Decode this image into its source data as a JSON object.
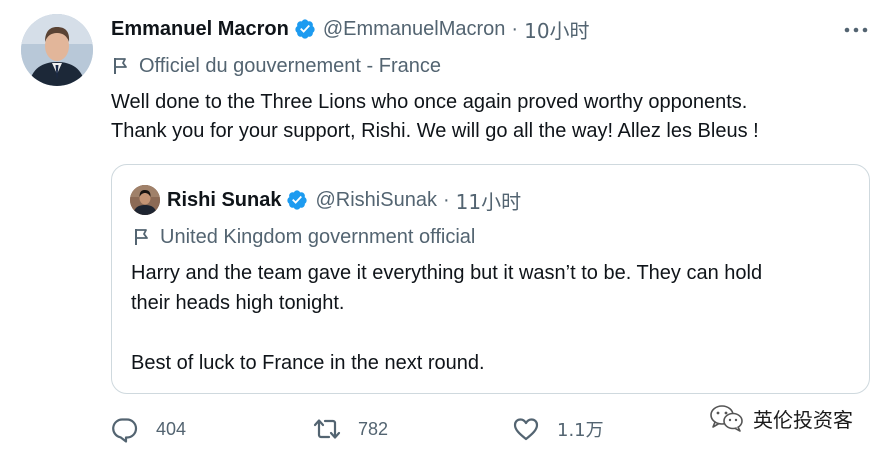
{
  "tweet": {
    "author_name": "Emmanuel Macron",
    "author_handle": "@EmmanuelMacron",
    "separator": "·",
    "time": "10小时",
    "label": "Officiel du gouvernement - France",
    "text_lines": [
      "Well done to the Three Lions who once again proved worthy opponents.",
      "Thank you for your support, Rishi. We will go all the way! Allez les Bleus !"
    ]
  },
  "quoted_tweet": {
    "author_name": "Rishi Sunak",
    "author_handle": "@RishiSunak",
    "separator": "·",
    "time": "11小时",
    "label": "United Kingdom government official",
    "text_lines": [
      "Harry and the team gave it everything but it wasn’t to be. They can hold",
      "their heads high tonight.",
      "Best of luck to France in the next round."
    ]
  },
  "actions": {
    "replies": "404",
    "retweets": "782",
    "likes": "1.1万"
  },
  "watermark": {
    "text": "英伦投资客"
  },
  "colors": {
    "verified_blue": "#1d9bf0",
    "text_primary": "#0f1419",
    "text_secondary": "#536471",
    "border": "#cfd9de"
  }
}
